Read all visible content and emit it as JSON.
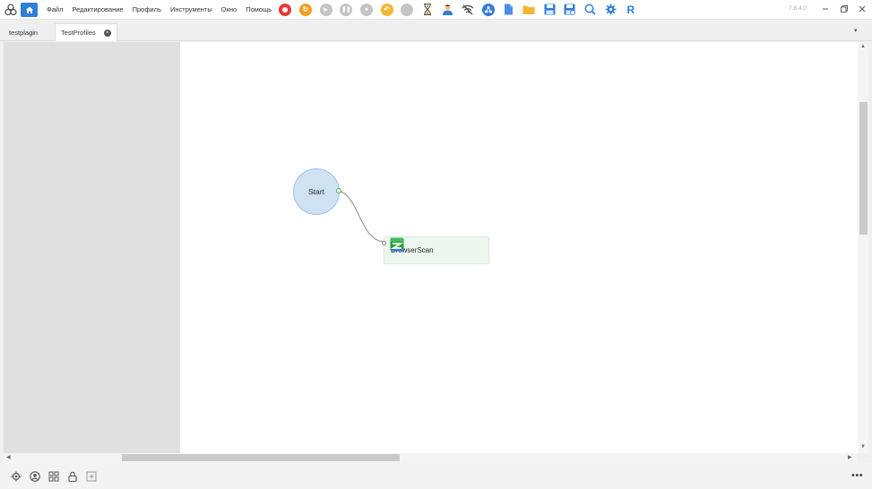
{
  "menu": {
    "items": [
      "Файл",
      "Редактирование",
      "Профиль",
      "Инструменты",
      "Окно",
      "Помощь"
    ]
  },
  "toolbar": {
    "icons": [
      {
        "name": "stop-red-icon",
        "color": "#e53935"
      },
      {
        "name": "refresh-orange-icon",
        "color": "#f0a020"
      },
      {
        "name": "play-gray-icon",
        "color": "#bdbdbd"
      },
      {
        "name": "pause-gray-icon",
        "color": "#bdbdbd"
      },
      {
        "name": "stop-gray-icon",
        "color": "#bdbdbd"
      },
      {
        "name": "undo-yellow-icon",
        "color": "#f2b632"
      },
      {
        "name": "circle-gray-icon",
        "color": "#c4c4c4"
      },
      {
        "name": "hourglass-icon",
        "color": "#e08a2e"
      },
      {
        "name": "user-icon",
        "color": "#3a7bd5"
      },
      {
        "name": "wifi-off-icon",
        "color": "#555555"
      },
      {
        "name": "network-icon",
        "color": "#2f7ed8"
      },
      {
        "name": "document-icon",
        "color": "#2f7ed8"
      },
      {
        "name": "folder-icon",
        "color": "#f2b632"
      },
      {
        "name": "save-icon",
        "color": "#2f7ed8"
      },
      {
        "name": "save-as-icon",
        "color": "#2f7ed8"
      },
      {
        "name": "search-icon",
        "color": "#2f7ed8"
      },
      {
        "name": "gear-icon",
        "color": "#2f7ed8"
      },
      {
        "name": "r-logo-icon",
        "color": "#2f7ed8"
      }
    ]
  },
  "version": "7.8.4.0",
  "tabs": [
    {
      "label": "testplagin",
      "active": false
    },
    {
      "label": "TestProfiles",
      "active": true
    }
  ],
  "canvas": {
    "start_label": "Start",
    "action_label": "BrowserScan"
  },
  "colors": {
    "accent": "#2f7ed8",
    "start_fill": "#cfe2f4",
    "action_fill": "#eef7ef"
  }
}
